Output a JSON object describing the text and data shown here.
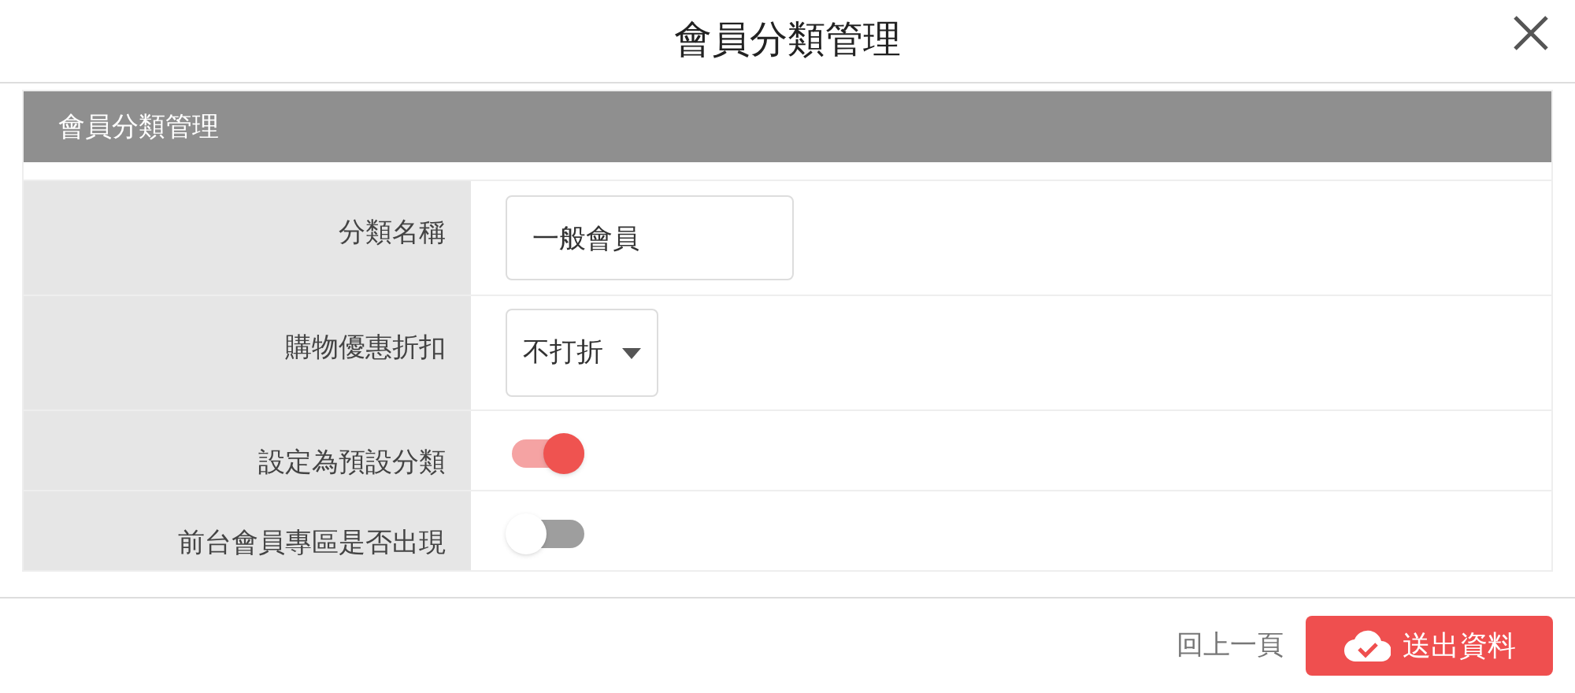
{
  "dialog": {
    "title": "會員分類管理"
  },
  "panel": {
    "title": "會員分類管理"
  },
  "rows": [
    {
      "kind": "text",
      "label": "分類名稱",
      "value": "一般會員"
    },
    {
      "kind": "select",
      "label": "購物優惠折扣",
      "value": "不打折"
    },
    {
      "kind": "switch",
      "label": "設定為預設分類",
      "on": true
    },
    {
      "kind": "switch",
      "label": "前台會員專區是否出現",
      "on": false
    }
  ],
  "footer": {
    "back": "回上一頁",
    "submit": "送出資料"
  }
}
